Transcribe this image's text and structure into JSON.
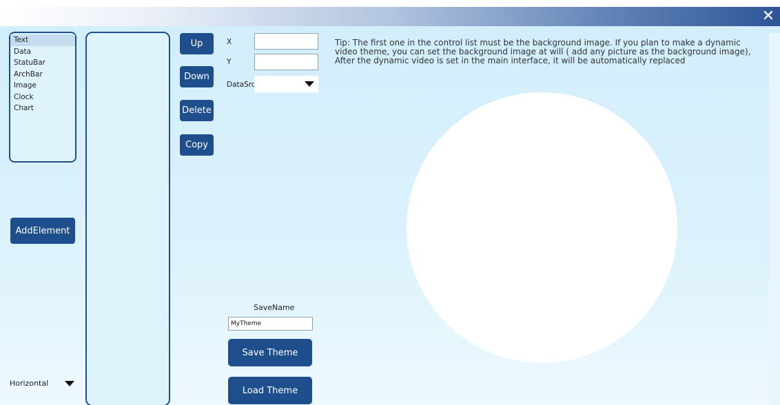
{
  "titlebar": {
    "close_glyph": "✕"
  },
  "element_types": [
    "Text",
    "Data",
    "StatuBar",
    "ArchBar",
    "Image",
    "Clock",
    "Chart"
  ],
  "selected_element_type": "Text",
  "buttons": {
    "add_element": "AddElement",
    "up": "Up",
    "down": "Down",
    "delete": "Delete",
    "copy": "Copy",
    "save_theme": "Save Theme",
    "load_theme": "Load Theme"
  },
  "orientation": {
    "value": "Horizontal"
  },
  "properties": {
    "x_label": "X",
    "x_value": "",
    "y_label": "Y",
    "y_value": "",
    "datasrc_label": "DataSrc",
    "datasrc_value": ""
  },
  "save": {
    "label": "SaveName",
    "value": "MyTheme"
  },
  "tip": "Tip: The first one in the control list must be the background image. If you plan to make a dynamic video theme, you can set the background image at will ( add any picture as the background image), After the dynamic video is set in the main interface, it will be automatically replaced",
  "icons": {
    "close": "close-icon",
    "dropdown": "chevron-down-icon"
  },
  "colors": {
    "button_bg": "#1f4e8c",
    "panel_border": "#1f4e8c",
    "content_bg": "#d2eefb"
  }
}
